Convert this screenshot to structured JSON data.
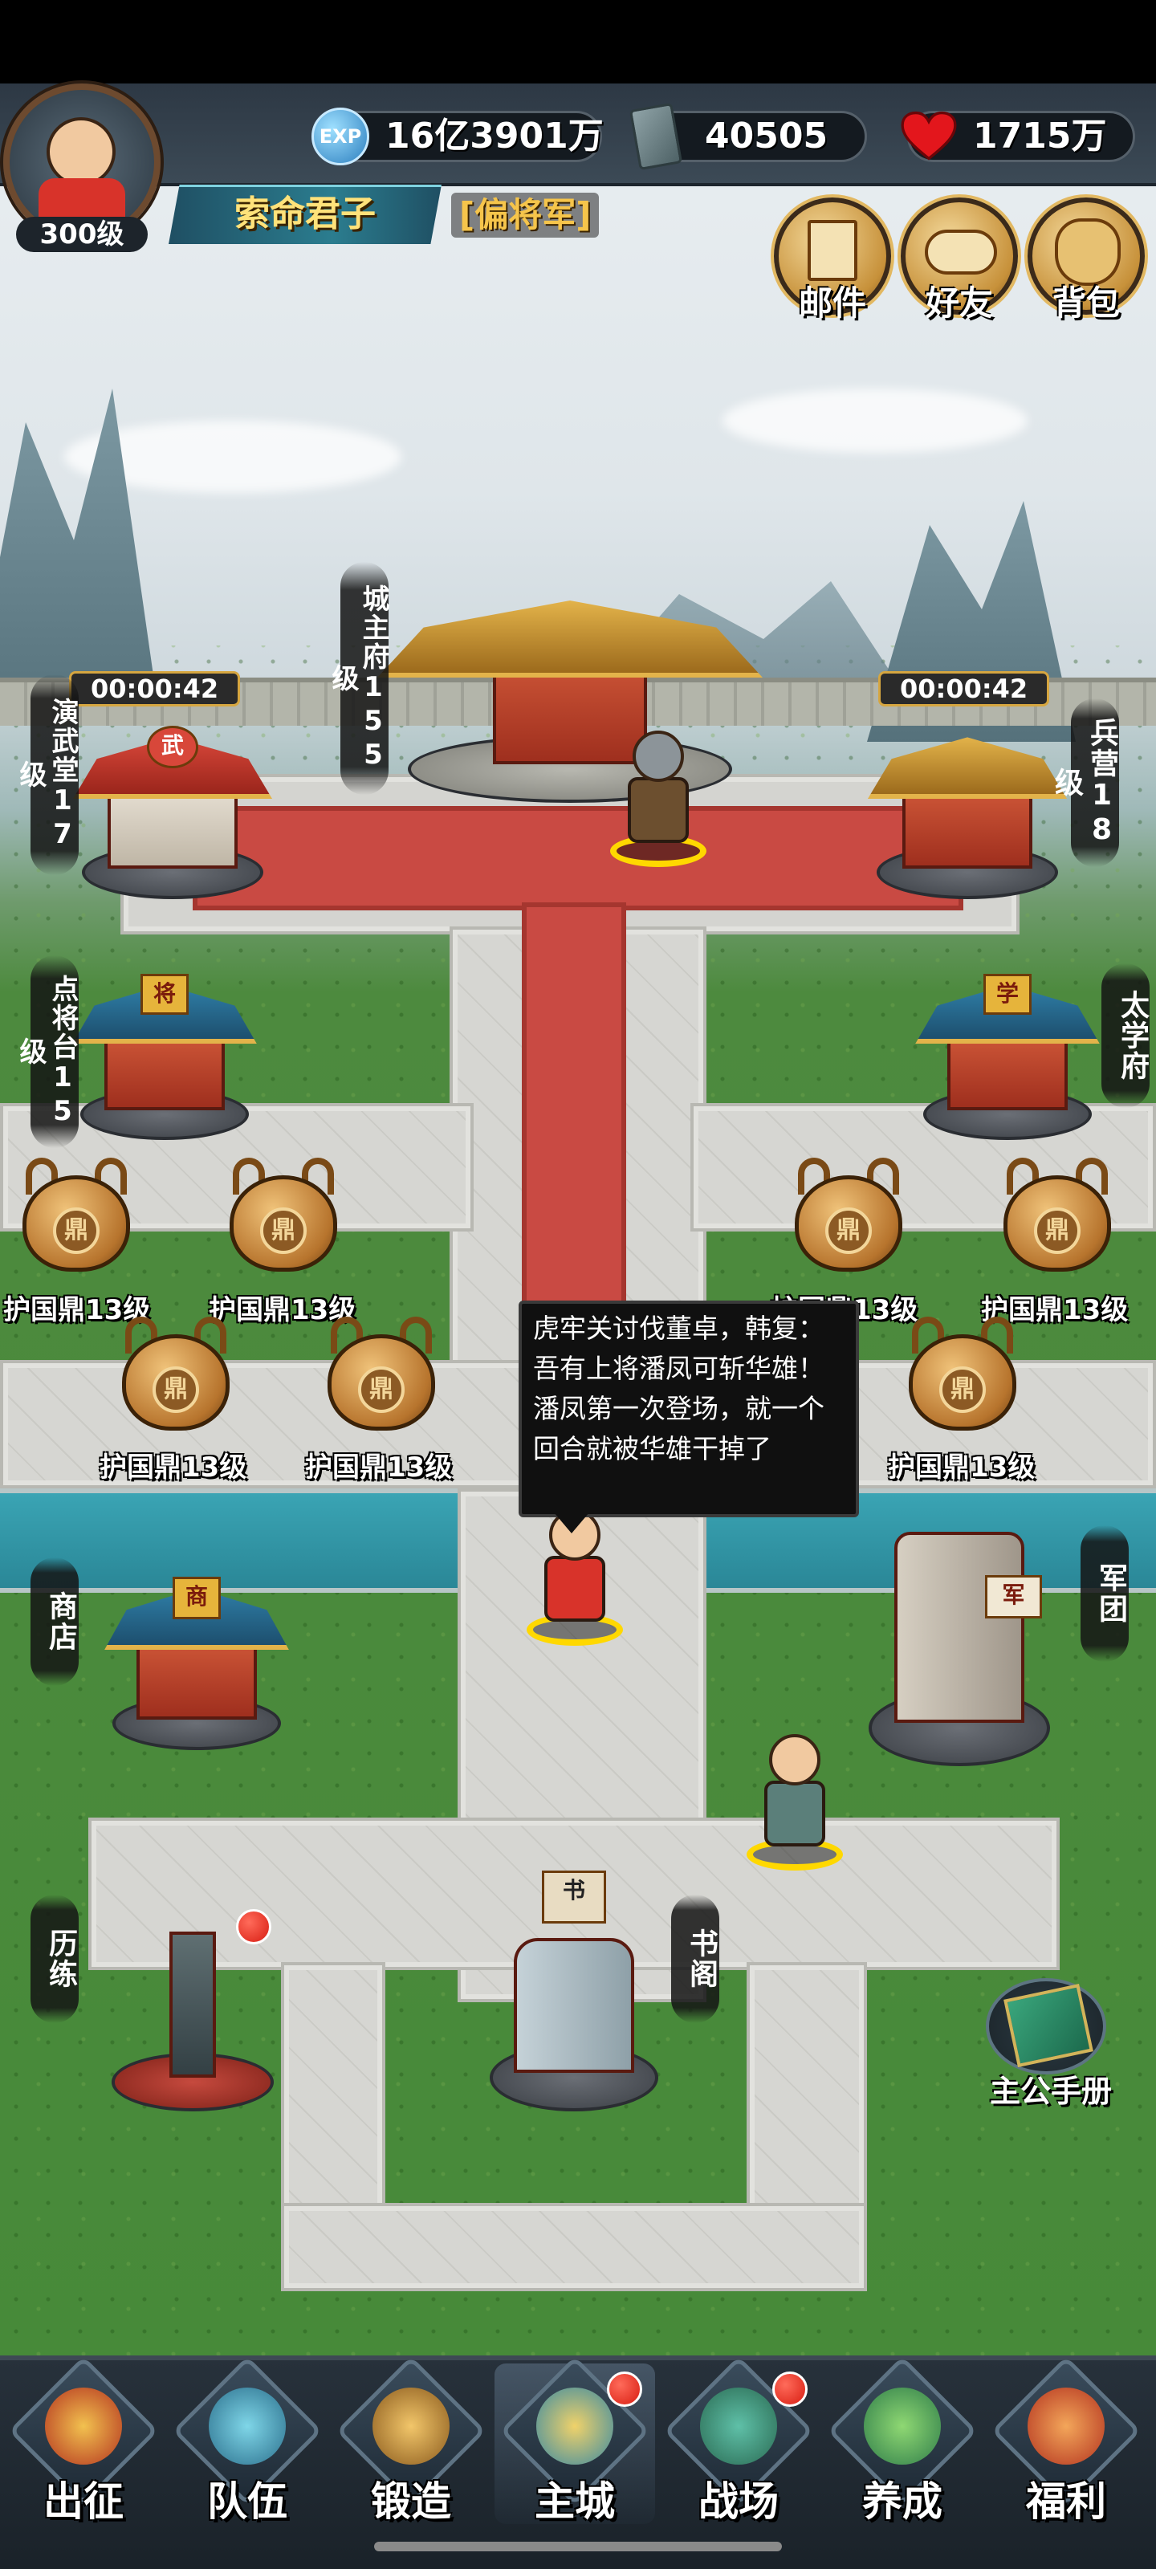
{
  "player": {
    "level": "300级",
    "name": "索命君子",
    "rank": "[偏将军]"
  },
  "resources": {
    "exp_icon_text": "EXP",
    "exp": "16亿3901万",
    "jade": "40505",
    "hp": "1715万"
  },
  "top_buttons": [
    {
      "label": "邮件",
      "icon": "mail-icon"
    },
    {
      "label": "好友",
      "icon": "handshake-icon"
    },
    {
      "label": "背包",
      "icon": "bag-icon"
    }
  ],
  "buildings": {
    "city_hall": {
      "label": "城主府155级"
    },
    "martial_hall": {
      "label": "演武堂17级",
      "timer": "00:00:42",
      "plaque": "武"
    },
    "barracks": {
      "label": "兵营18级",
      "timer": "00:00:42"
    },
    "general_stage": {
      "label": "点将台15级",
      "plaque": "将"
    },
    "academy": {
      "label": "太学府",
      "plaque": "学"
    },
    "shop": {
      "label": "商店",
      "plaque": "商"
    },
    "legion": {
      "label": "军团",
      "plaque": "军"
    },
    "training": {
      "label": "历练"
    },
    "library": {
      "label": "书阁",
      "plaque": "书"
    }
  },
  "dings": {
    "mark": "鼎",
    "row1": [
      "护国鼎13级",
      "护国鼎13级",
      "护国鼎13级",
      "护国鼎13级"
    ],
    "row2": [
      "护国鼎13级",
      "护国鼎13级",
      "护国鼎13级"
    ]
  },
  "dialog": {
    "text": "虎牢关讨伐董卓，韩复：吾有上将潘凤可斩华雄！潘凤第一次登场，就一个回合就被华雄干掉了"
  },
  "manual": {
    "label": "主公手册"
  },
  "bottom_nav": [
    {
      "label": "出征",
      "icon": "crossed-swords-icon",
      "active": false
    },
    {
      "label": "队伍",
      "icon": "helmet-icon",
      "active": false
    },
    {
      "label": "锻造",
      "icon": "anvil-hammer-icon",
      "active": false
    },
    {
      "label": "主城",
      "icon": "castle-icon",
      "active": true
    },
    {
      "label": "战场",
      "icon": "battle-drum-icon",
      "active": false
    },
    {
      "label": "养成",
      "icon": "pagoda-icon",
      "active": false
    },
    {
      "label": "福利",
      "icon": "gift-palace-icon",
      "active": false
    }
  ],
  "colors": {
    "accent_gold": "#ffe27a",
    "notification_red": "#d81d12",
    "carpet_red": "#c94a43",
    "grass_green": "#478a39"
  }
}
